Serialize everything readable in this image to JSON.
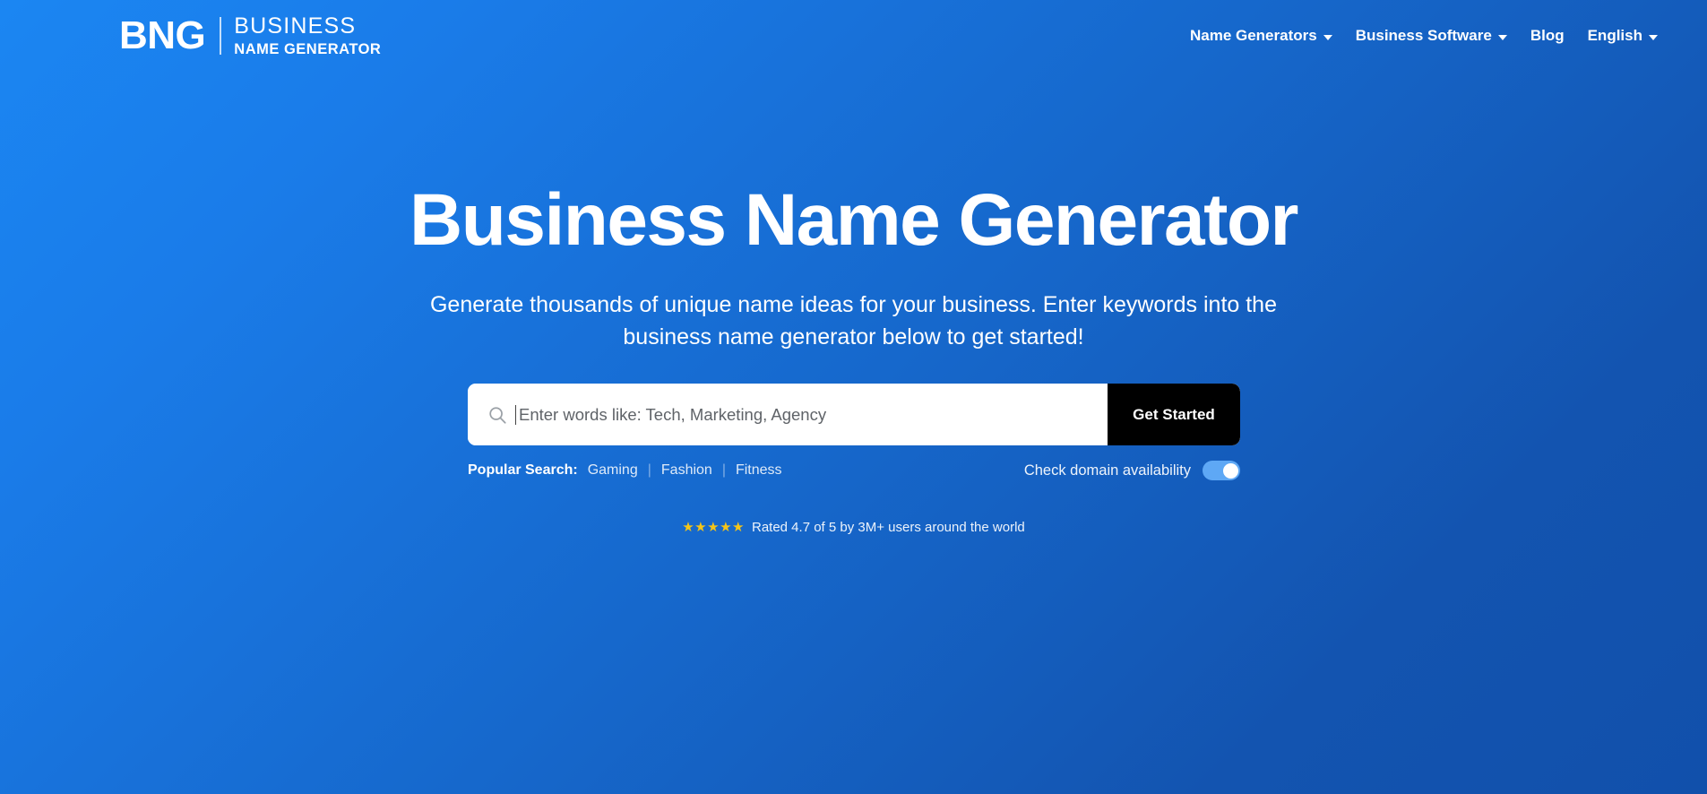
{
  "brand": {
    "mark": "BNG",
    "line1": "BUSINESS",
    "line2": "NAME GENERATOR",
    "accent_color": "#1668cc",
    "gradient_from": "#1b86f2",
    "gradient_to": "#1150ab"
  },
  "nav": {
    "items": [
      {
        "label": "Name Generators",
        "has_dropdown": true
      },
      {
        "label": "Business Software",
        "has_dropdown": true
      },
      {
        "label": "Blog",
        "has_dropdown": false
      },
      {
        "label": "English",
        "has_dropdown": true
      }
    ]
  },
  "hero": {
    "title": "Business Name Generator",
    "subtitle": "Generate thousands of unique name ideas for your business. Enter keywords into the business name generator below to get started!"
  },
  "search": {
    "icon": "search-icon",
    "placeholder": "Enter words like: Tech, Marketing, Agency",
    "value": "",
    "button_label": "Get Started",
    "button_color": "#000000"
  },
  "popular": {
    "label": "Popular Search:",
    "separator": "|",
    "links": [
      "Gaming",
      "Fashion",
      "Fitness"
    ]
  },
  "domain": {
    "label": "Check domain availability",
    "toggle_on": true,
    "toggle_color": "#5ea8f5"
  },
  "rating": {
    "stars": "★★★★★",
    "star_color": "#f5c518",
    "text": "Rated 4.7 of 5 by 3M+ users around the world"
  }
}
